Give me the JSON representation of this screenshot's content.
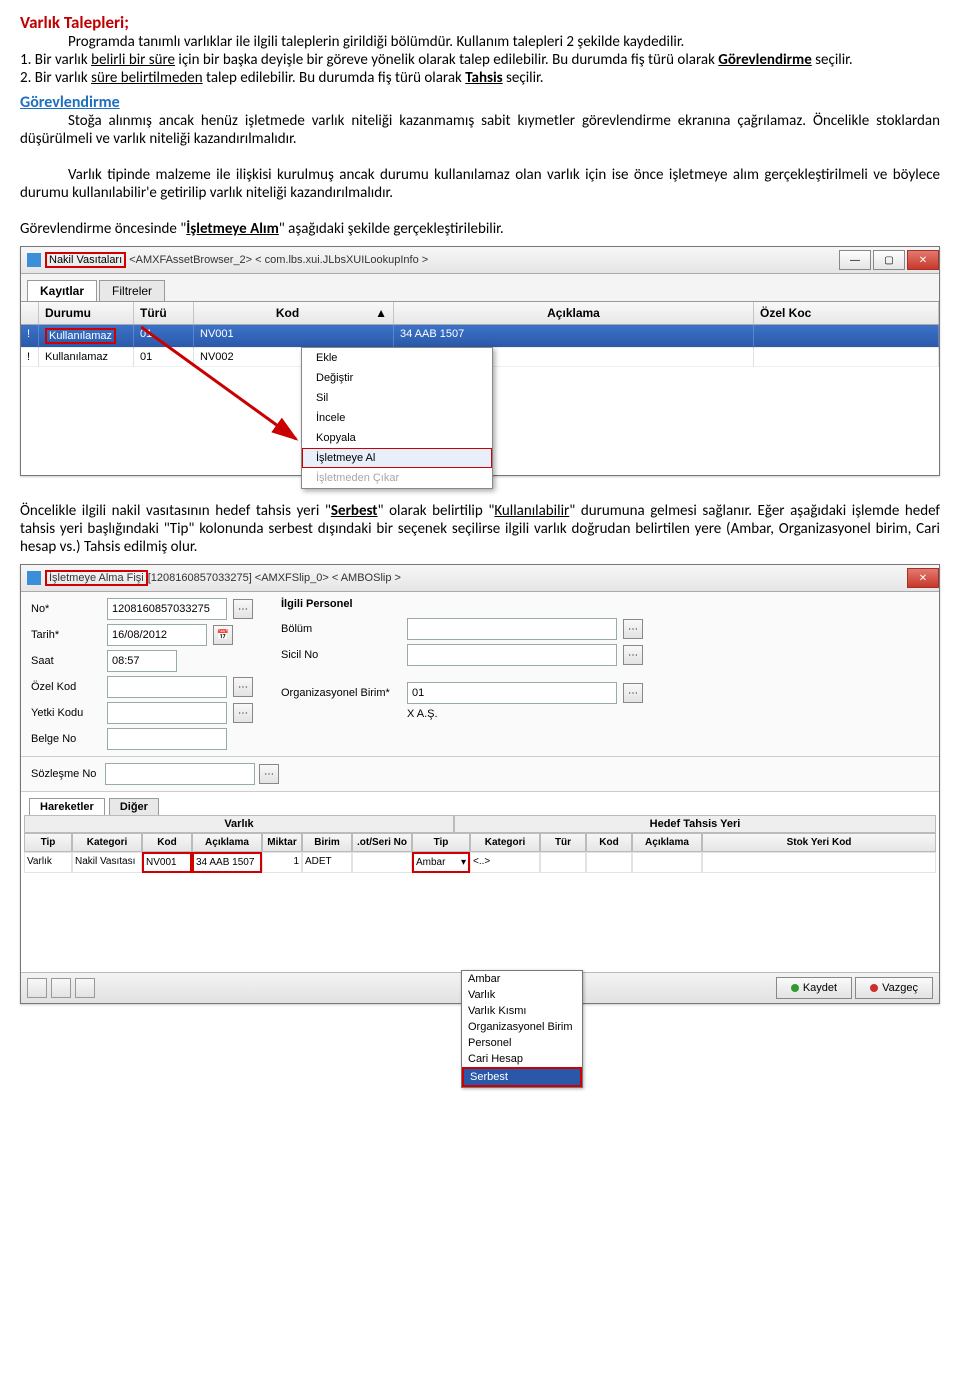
{
  "doc": {
    "title": "Varlık Talepleri;",
    "p1": "Programda tanımlı varlıklar ile ilgili taleplerin girildiği bölümdür. Kullanım talepleri 2 şekilde kaydedilir.",
    "li1_prefix": "1. Bir varlık ",
    "li1_u1": "belirli bir süre",
    "li1_mid": " için bir başka deyişle bir göreve yönelik olarak talep edilebilir. Bu durumda fiş türü olarak ",
    "li1_u2": "Görevlendirme",
    "li1_suf": " seçilir.",
    "li2_prefix": "2. Bir varlık ",
    "li2_u1": "süre belirtilmeden",
    "li2_mid": " talep edilebilir. Bu durumda fiş türü olarak ",
    "li2_u2": "Tahsis",
    "li2_suf": " seçilir.",
    "sec_head": "Görevlendirme",
    "p2": "Stoğa alınmış ancak henüz işletmede varlık niteliği kazanmamış sabit kıymetler görevlendirme ekranına çağrılamaz. Öncelikle stoklardan düşürülmeli ve varlık niteliği kazandırılmalıdır.",
    "p3": "Varlık tipinde malzeme ile ilişkisi kurulmuş ancak durumu kullanılamaz olan varlık için ise önce işletmeye alım gerçekleştirilmeli ve böylece durumu kullanılabilir'e getirilip varlık niteliği kazandırılmalıdır.",
    "p4_a": "Görevlendirme öncesinde \"",
    "p4_u": "İşletmeye Alım",
    "p4_b": "\" aşağıdaki şekilde gerçekleştirilebilir.",
    "p5_a": "Öncelikle ilgili nakil vasıtasının hedef tahsis yeri \"",
    "p5_u1": "Serbest",
    "p5_b": "\" olarak belirtilip \"",
    "p5_u2": "Kullanılabilir",
    "p5_c": "\" durumuna gelmesi sağlanır. Eğer aşağıdaki işlemde hedef tahsis yeri başlığındaki \"Tip\" kolonunda serbest dışındaki bir seçenek seçilirse ilgili varlık doğrudan belirtilen yere (Ambar, Organizasyonel birim, Cari hesap vs.) Tahsis edilmiş olur."
  },
  "win1": {
    "title_hl": "Nakil Vasıtaları",
    "title_rest": " <AMXFAssetBrowser_2> < com.lbs.xui.JLbsXUILookupInfo >",
    "tab1": "Kayıtlar",
    "tab2": "Filtreler",
    "cols": {
      "c1": "Durumu",
      "c2": "Türü",
      "c3": "Kod",
      "c4": "Açıklama",
      "c5": "Özel Koc"
    },
    "row1": {
      "d": "Kullanılamaz",
      "t": "01",
      "k": "NV001",
      "a": "34 AAB 1507"
    },
    "row2": {
      "d": "Kullanılamaz",
      "t": "01",
      "k": "NV002",
      "a": ""
    },
    "menu": {
      "m1": "Ekle",
      "m2": "Değiştir",
      "m3": "Sil",
      "m4": "İncele",
      "m5": "Kopyala",
      "m6": "İşletmeye Al",
      "m7": "İşletmeden Çıkar"
    }
  },
  "win2": {
    "title_hl": "İşletmeye Alma Fişi",
    "title_rest": "[1208160857033275] <AMXFSlip_0> < AMBOSlip >",
    "labels": {
      "no": "No*",
      "tarih": "Tarih*",
      "saat": "Saat",
      "ozelkod": "Özel Kod",
      "yetki": "Yetki Kodu",
      "belge": "Belge No",
      "personel": "İlgili Personel",
      "bolum": "Bölüm",
      "sicil": "Sicil No",
      "org": "Organizasyonel Birim*",
      "sozlesme": "Sözleşme No"
    },
    "vals": {
      "no": "1208160857033275",
      "tarih": "16/08/2012",
      "saat": "08:57",
      "org": "01",
      "orgname": "X A.Ş."
    },
    "tabs": {
      "t1": "Hareketler",
      "t2": "Diğer"
    },
    "group": {
      "g1": "Varlık",
      "g2": "Hedef Tahsis Yeri"
    },
    "cols": {
      "c1": "Tip",
      "c2": "Kategori",
      "c3": "Kod",
      "c4": "Açıklama",
      "c5": "Miktar",
      "c6": "Birim",
      "c7": ".ot/Seri No",
      "c8": "Tip",
      "c9": "Kategori",
      "c10": "Tür",
      "c11": "Kod",
      "c12": "Açıklama",
      "c13": "Stok Yeri Kod"
    },
    "row": {
      "tip": "Varlık",
      "kat": "Nakil Vasıtası",
      "kod": "NV001",
      "ac": "34 AAB 1507",
      "mik": "1",
      "birim": "ADET",
      "htip": "Ambar",
      "ellipsis": "<..>"
    },
    "dd": {
      "o1": "Ambar",
      "o2": "Varlık",
      "o3": "Varlık Kısmı",
      "o4": "Organizasyonel Birim",
      "o5": "Personel",
      "o6": "Cari Hesap",
      "o7": "Serbest"
    },
    "btn": {
      "save": "Kaydet",
      "cancel": "Vazgeç"
    }
  }
}
